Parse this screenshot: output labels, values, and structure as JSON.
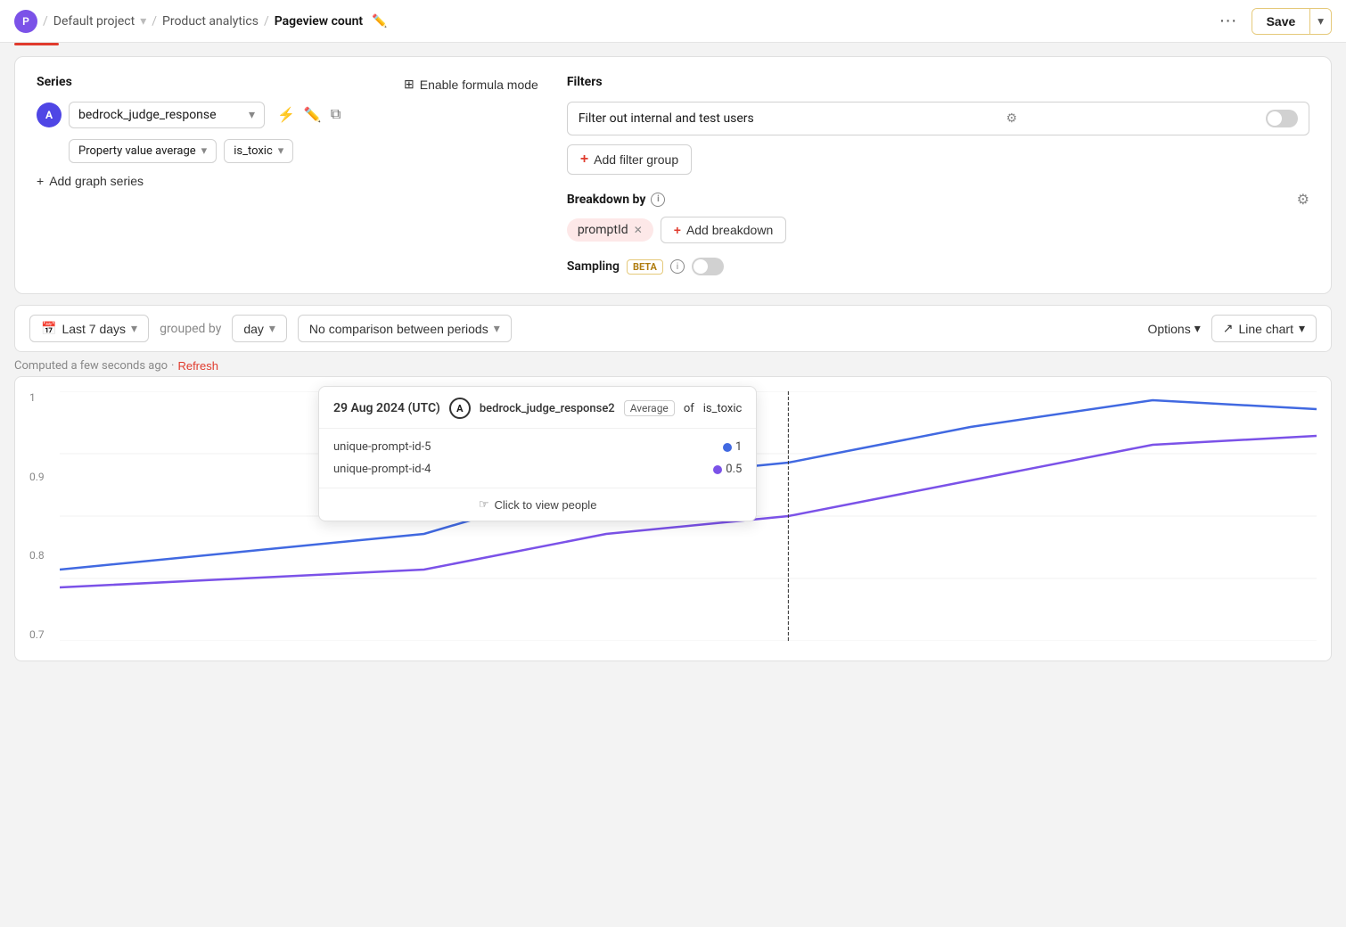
{
  "topnav": {
    "avatar_letter": "P",
    "default_project": "Default project",
    "product_analytics": "Product analytics",
    "current_page": "Pageview count",
    "more_label": "···",
    "save_label": "Save"
  },
  "series_section": {
    "title": "Series",
    "badge_letter": "A",
    "series_name": "bedrock_judge_response",
    "property_value": "Property value average",
    "is_toxic": "is_toxic",
    "add_series": "Add graph series"
  },
  "formula": {
    "label": "Enable formula mode"
  },
  "filters": {
    "title": "Filters",
    "filter_label": "Filter out internal and test users",
    "add_filter_group": "Add filter group"
  },
  "breakdown": {
    "title": "Breakdown by",
    "tag": "promptId",
    "add_breakdown": "Add breakdown"
  },
  "sampling": {
    "label": "Sampling",
    "beta": "BETA"
  },
  "controls": {
    "date_range": "Last 7 days",
    "grouped_by": "grouped by",
    "group_unit": "day",
    "comparison": "No comparison between periods",
    "options": "Options",
    "chart_type": "Line chart"
  },
  "computed": {
    "text": "Computed a few seconds ago",
    "separator": "·",
    "refresh": "Refresh"
  },
  "chart": {
    "y_labels": [
      "1",
      "0.9",
      "0.8",
      "0.7"
    ],
    "tooltip": {
      "date": "29 Aug 2024 (UTC)",
      "avatar_letter": "A",
      "series": "bedrock_judge_response2",
      "badge": "Average",
      "of_label": "of",
      "of_field": "is_toxic",
      "rows": [
        {
          "label": "unique-prompt-id-5",
          "value": "1",
          "color": "#4169e1"
        },
        {
          "label": "unique-prompt-id-4",
          "value": "0.5",
          "color": "#7b52e8"
        }
      ],
      "click_people": "Click to view people"
    }
  }
}
